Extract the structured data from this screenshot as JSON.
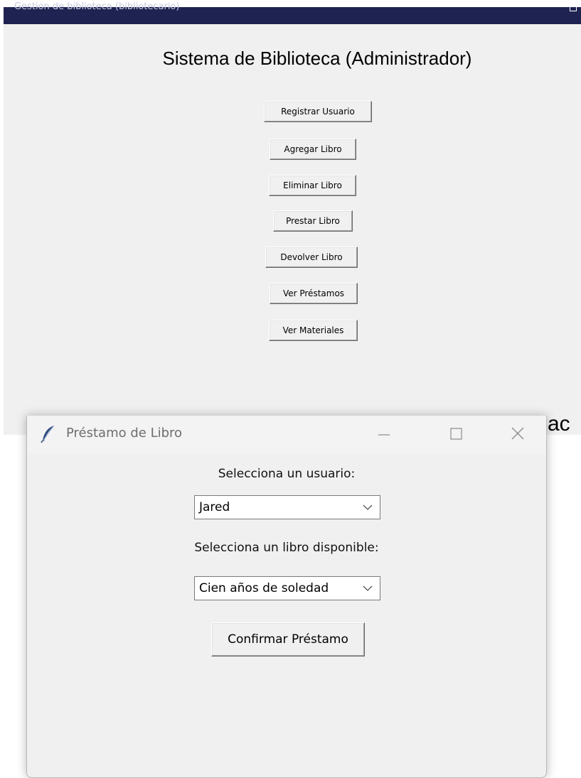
{
  "main_window": {
    "title": "Gestion de biblioteca (bibliotecario)",
    "heading": "Sistema de Biblioteca (Administrador)",
    "buttons": [
      "Registrar Usuario",
      "Agregar Libro",
      "Eliminar Libro",
      "Prestar Libro",
      "Devolver Libro",
      "Ver Préstamos",
      "Ver Materiales"
    ],
    "peek_text": "ac"
  },
  "dialog": {
    "title": "Préstamo de Libro",
    "user_label": "Selecciona un usuario:",
    "user_selected": "Jared",
    "book_label": "Selecciona un libro disponible:",
    "book_selected": "Cien años de soledad",
    "confirm_label": "Confirmar Préstamo"
  },
  "icons": {
    "dialog_app_icon": "feather-icon",
    "minimize": "minimize-icon",
    "maximize": "maximize-icon",
    "close": "close-icon",
    "dropdown": "chevron-down-icon"
  },
  "colors": {
    "main_titlebar": "#1f2352",
    "window_bg": "#f0f0f0",
    "dialog_titlebar": "#f3f3f3"
  }
}
